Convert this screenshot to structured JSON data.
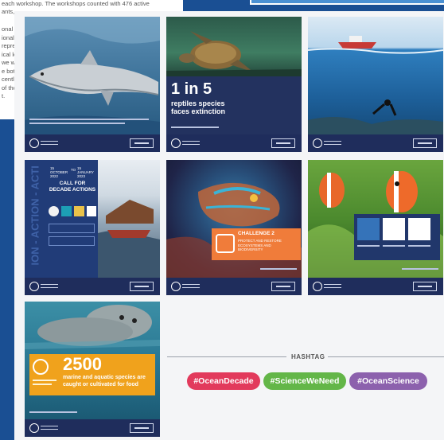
{
  "background_doc": {
    "line1": "each workshop. The workshops counted with 476 active",
    "line2": "ants, ...",
    "para_lines": [
      "onal p",
      "ional",
      "represe",
      "ical le",
      "we wid",
      "e bott"
    ],
    "para2_lines": [
      "cently",
      "of the",
      "t."
    ]
  },
  "cards": {
    "shark": {},
    "turtle": {
      "stat": "1 in 5",
      "caption": "reptiles species faces extinction"
    },
    "boat": {},
    "decade": {
      "date_from": "15 OCTOBER 2022",
      "to": "TO",
      "date_to": "15 JANUARY 2023",
      "title": "CALL FOR DECADE ACTIONS",
      "side_text": "ION - ACTION - ACTI"
    },
    "fish": {
      "label": "CHALLENGE 2",
      "caption": "PROTECT AND RESTORE ECOSYSTEMS AND BIODIVERSITY"
    },
    "clown": {},
    "seal": {
      "stat": "2500",
      "caption": "marine and aquatic species are caught or cultivated for food"
    }
  },
  "hashtag": {
    "title": "HASHTAG",
    "tags": [
      "#OceanDecade",
      "#ScienceWeNeed",
      "#OceanScience"
    ]
  },
  "colors": {
    "page_bg": "#1a4f93",
    "panel_bg": "#f4f5f7",
    "card_navy": "#222f5e",
    "tag_red": "#e23a5c",
    "tag_green": "#63b648",
    "tag_purple": "#8c61ad"
  }
}
